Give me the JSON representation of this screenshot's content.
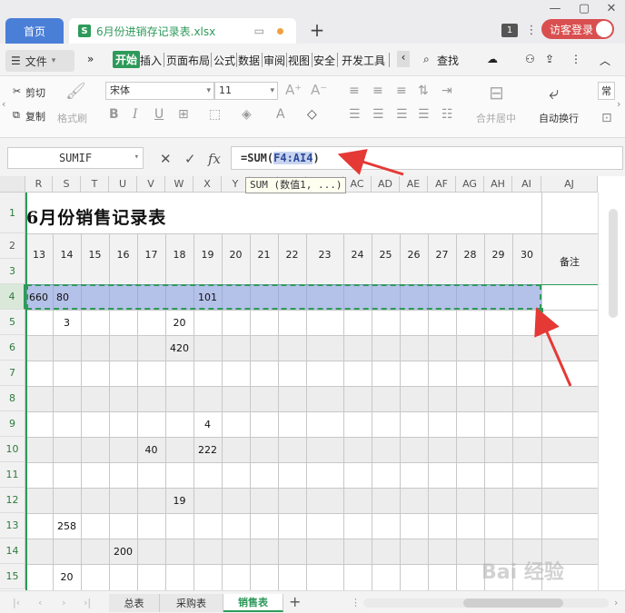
{
  "titlebar": {
    "home_tab": "首页",
    "file_tab": "6月份进销存记录表.xlsx",
    "file_icon": "S",
    "badge": "1",
    "login": "访客登录"
  },
  "menu": {
    "file": "文件",
    "items": [
      "开始",
      "插入",
      "页面布局",
      "公式",
      "数据",
      "审阅",
      "视图",
      "安全",
      "开发工具"
    ],
    "search": "查找"
  },
  "ribbon": {
    "cut": "剪切",
    "copy": "复制",
    "format_painter": "格式刷",
    "font": "宋体",
    "size": "11",
    "merge": "合并居中",
    "wrap": "自动换行",
    "cut_overflow": "常"
  },
  "formula_bar": {
    "name_box": "SUMIF",
    "prefix": "=SUM(",
    "ref": "F4:AI4",
    "suffix": ")",
    "tooltip": "SUM (数值1, ...)"
  },
  "columns": [
    "R",
    "S",
    "T",
    "U",
    "V",
    "W",
    "X",
    "Y",
    "Z",
    "AA",
    "AB",
    "AC",
    "AD",
    "AE",
    "AF",
    "AG",
    "AH",
    "AI",
    "AJ"
  ],
  "sheet": {
    "title": "6月份销售记录表",
    "days": [
      "13",
      "14",
      "15",
      "16",
      "17",
      "18",
      "19",
      "20",
      "21",
      "22",
      "23",
      "24",
      "25",
      "26",
      "27",
      "28",
      "29",
      "30"
    ],
    "remark": "备注"
  },
  "rows": [
    {
      "num": "1"
    },
    {
      "num": "2"
    },
    {
      "num": "3"
    },
    {
      "num": "4"
    },
    {
      "num": "5"
    },
    {
      "num": "6"
    },
    {
      "num": "7"
    },
    {
      "num": "8"
    },
    {
      "num": "9"
    },
    {
      "num": "10"
    },
    {
      "num": "11"
    },
    {
      "num": "12"
    },
    {
      "num": "13"
    },
    {
      "num": "14"
    },
    {
      "num": "15"
    }
  ],
  "cells": {
    "r4_R": "660",
    "r4_S": "80",
    "r4_X": "101",
    "r5_S": "3",
    "r5_W": "20",
    "r6_W": "420",
    "r9_X": "4",
    "r10_V": "40",
    "r10_X": "222",
    "r12_W": "19",
    "r13_S": "258",
    "r14_U": "200",
    "r15_S": "20"
  },
  "sheet_tabs": [
    "总表",
    "采购表",
    "销售表"
  ],
  "active_sheet": "销售表",
  "watermark": "Bai 经验",
  "colors": {
    "accent": "#2e9a5a",
    "home_tab": "#4a7fd8",
    "login": "#d94f50",
    "arrow": "#e53935",
    "selection": "#8ca0dc"
  }
}
